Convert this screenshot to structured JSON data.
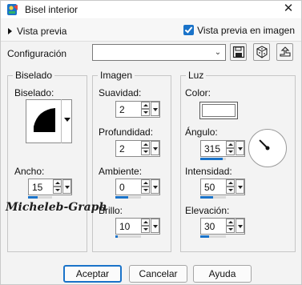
{
  "window": {
    "title": "Bisel interior",
    "close_glyph": "✕"
  },
  "preview": {
    "toggle_label": "Vista previa",
    "image_preview_label": "Vista previa en imagen",
    "image_preview_checked": true
  },
  "config": {
    "label": "Configuración",
    "value": "",
    "arrow_glyph": "⌄"
  },
  "icons": [
    "app-icon",
    "save-icon",
    "random-dice-icon",
    "reset-icon"
  ],
  "bevel": {
    "group_title": "Biselado",
    "shape_label": "Biselado:",
    "width_label": "Ancho:",
    "width_value": "15",
    "width_fill": 0.4
  },
  "image": {
    "group_title": "Imagen",
    "smoothness_label": "Suavidad:",
    "smoothness_value": "2",
    "depth_label": "Profundidad:",
    "depth_value": "2",
    "ambient_label": "Ambiente:",
    "ambient_value": "0",
    "ambient_fill": 0.5,
    "brightness_label": "Brillo:",
    "brightness_value": "10",
    "brightness_fill": 0.1
  },
  "light": {
    "group_title": "Luz",
    "color_label": "Color:",
    "color_value": "#ffffff",
    "angle_label": "Ángulo:",
    "angle_value": "315",
    "angle_degrees": 315,
    "angle_fill": 0.875,
    "intensity_label": "Intensidad:",
    "intensity_value": "50",
    "intensity_fill": 0.5,
    "elevation_label": "Elevación:",
    "elevation_value": "30",
    "elevation_fill": 0.33
  },
  "watermark": "Micheleb-Graph",
  "buttons": {
    "ok": "Aceptar",
    "cancel": "Cancelar",
    "help": "Ayuda"
  },
  "colors": {
    "accent": "#1a73c9"
  }
}
